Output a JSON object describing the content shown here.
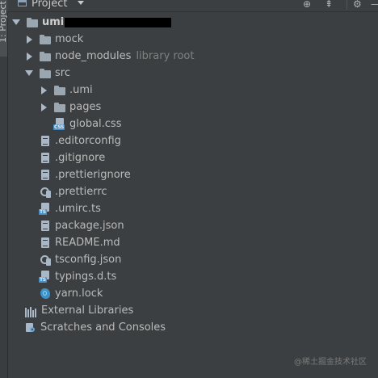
{
  "side_tab": {
    "label": "1: Project"
  },
  "toolbar": {
    "title": "Project",
    "icons": [
      "globe-icon",
      "collapse-icon",
      "gear-icon",
      "minimize-icon"
    ]
  },
  "tree": {
    "root": {
      "label": "umi",
      "redacted": true
    },
    "items": [
      {
        "label": "mock",
        "type": "folder",
        "expanded": false
      },
      {
        "label": "node_modules",
        "hint": "library root",
        "type": "folder",
        "expanded": false
      },
      {
        "label": "src",
        "type": "folder",
        "expanded": true
      },
      {
        "label": ".umi",
        "type": "folder",
        "expanded": false
      },
      {
        "label": "pages",
        "type": "folder",
        "expanded": false
      },
      {
        "label": "global.css",
        "type": "css-file",
        "badge": "CSS"
      },
      {
        "label": ".editorconfig",
        "type": "file"
      },
      {
        "label": ".gitignore",
        "type": "file"
      },
      {
        "label": ".prettierignore",
        "type": "file"
      },
      {
        "label": ".prettierrc",
        "type": "config-file"
      },
      {
        "label": ".umirc.ts",
        "type": "ts-file",
        "badge": "TS"
      },
      {
        "label": "package.json",
        "type": "file"
      },
      {
        "label": "README.md",
        "type": "file"
      },
      {
        "label": "tsconfig.json",
        "type": "config-file"
      },
      {
        "label": "typings.d.ts",
        "type": "ts-file",
        "badge": "TS"
      },
      {
        "label": "yarn.lock",
        "type": "yarn-file"
      },
      {
        "label": "External Libraries",
        "type": "libraries"
      },
      {
        "label": "Scratches and Consoles",
        "type": "scratches"
      }
    ]
  },
  "watermark": "@稀土掘金技术社区"
}
